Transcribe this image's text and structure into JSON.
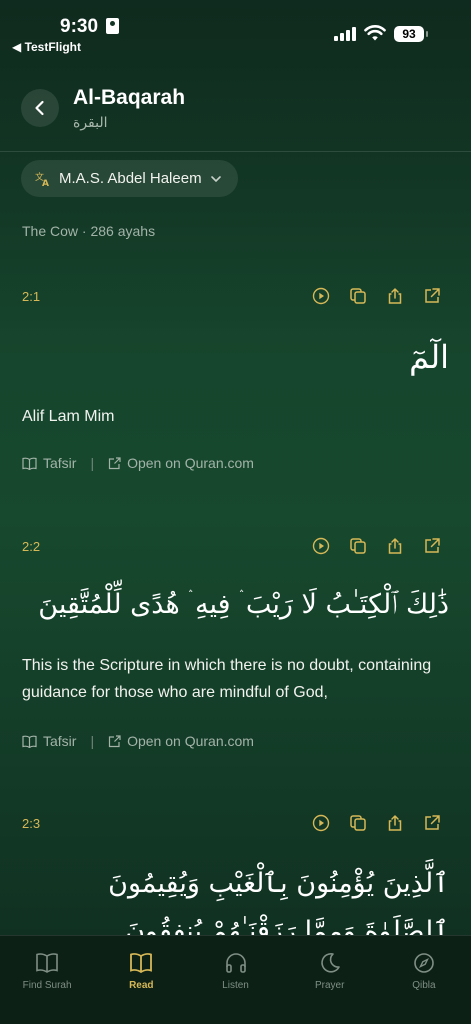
{
  "status_bar": {
    "time": "9:30",
    "back_app_label": "◀ TestFlight",
    "battery": "93"
  },
  "header": {
    "back_icon": "chevron-left-icon",
    "title": "Al-Baqarah",
    "subtitle_arabic": "البقرة"
  },
  "translator": {
    "icon": "translate-icon",
    "label": "M.A.S. Abdel Haleem",
    "chevron": "chevron-down-icon"
  },
  "surah_meta": "The Cow · 286 ayahs",
  "ayahs": [
    {
      "number": "2:1",
      "arabic": "الٓمٓ",
      "translation": "Alif Lam Mim",
      "tafsir_label": "Tafsir",
      "open_label": "Open on Quran.com"
    },
    {
      "number": "2:2",
      "arabic": "ذَٰلِكَ ٱلْكِتَـٰبُ لَا رَيْبَ ۛ فِيهِ ۛ هُدًى لِّلْمُتَّقِينَ",
      "translation": "This is the Scripture in which there is no doubt, containing guidance for those who are mindful of God,",
      "tafsir_label": "Tafsir",
      "open_label": "Open on Quran.com"
    },
    {
      "number": "2:3",
      "arabic": "ٱلَّذِينَ يُؤْمِنُونَ بِٱلْغَيْبِ وَيُقِيمُونَ ٱلصَّلَوٰةَ وَمِمَّا رَزَقْنَـٰهُمْ يُنفِقُونَ"
    }
  ],
  "tabs": [
    {
      "label": "Find Surah",
      "icon": "book-open-icon",
      "active": false
    },
    {
      "label": "Read",
      "icon": "book-icon",
      "active": true
    },
    {
      "label": "Listen",
      "icon": "headphones-icon",
      "active": false
    },
    {
      "label": "Prayer",
      "icon": "moon-icon",
      "active": false
    },
    {
      "label": "Qibla",
      "icon": "compass-icon",
      "active": false
    }
  ],
  "colors": {
    "accent_gold": "#d6b857",
    "background_green": "#16462d",
    "muted_text": "#a3b3a8"
  }
}
